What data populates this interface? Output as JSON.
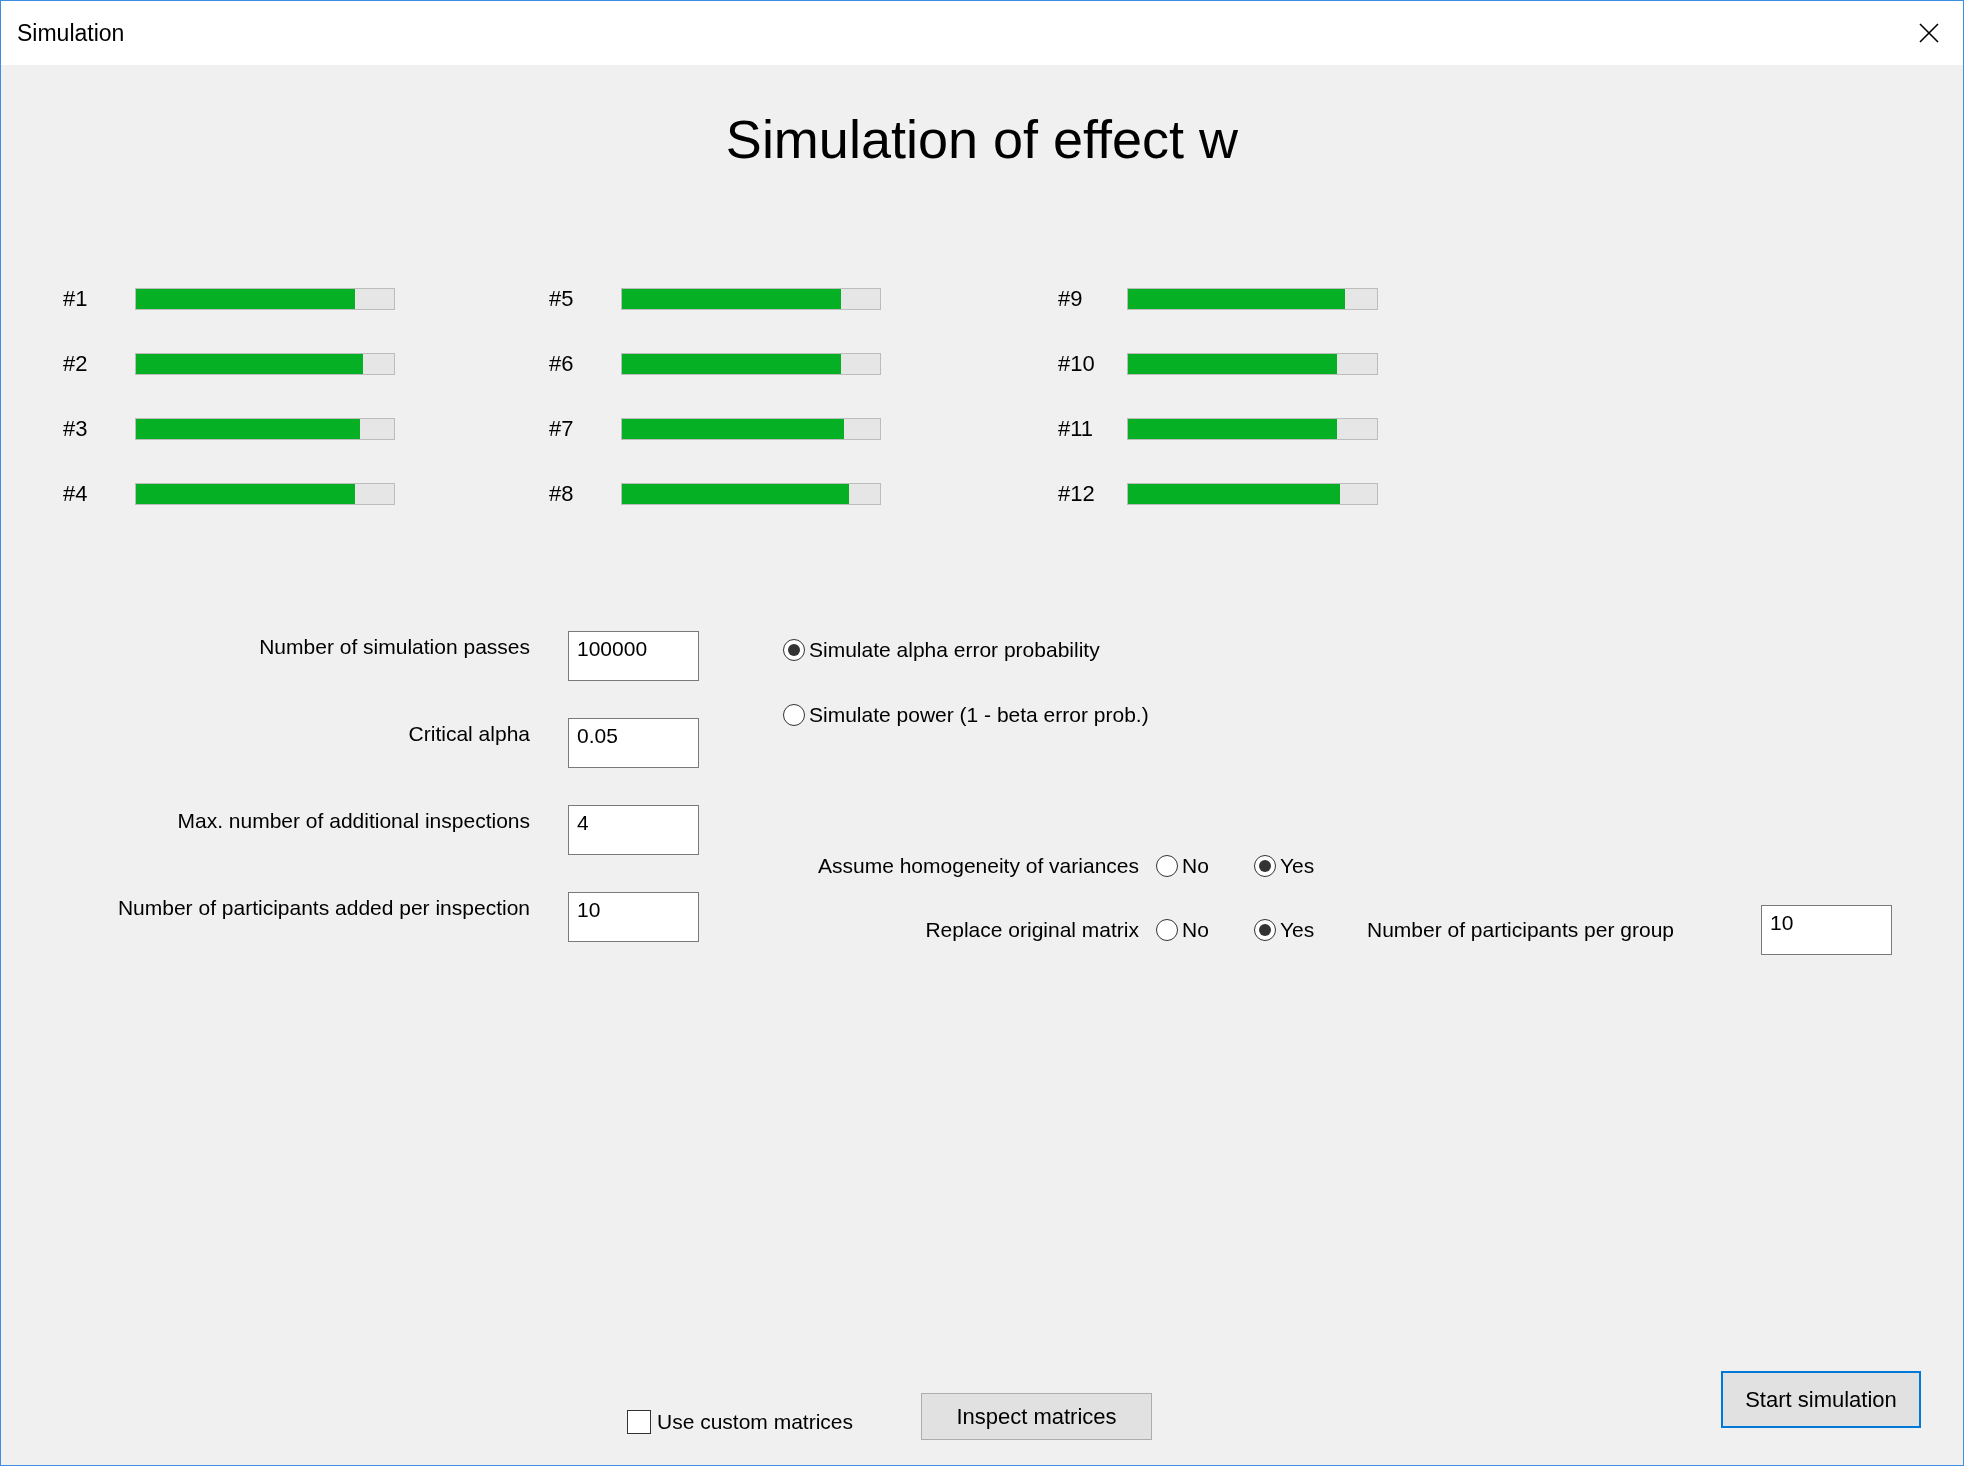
{
  "window": {
    "title": "Simulation"
  },
  "heading": "Simulation of effect w",
  "progress": [
    {
      "label": "#1",
      "level": 0.85
    },
    {
      "label": "#2",
      "level": 0.88
    },
    {
      "label": "#3",
      "level": 0.87
    },
    {
      "label": "#4",
      "level": 0.85
    },
    {
      "label": "#5",
      "level": 0.85
    },
    {
      "label": "#6",
      "level": 0.85
    },
    {
      "label": "#7",
      "level": 0.86
    },
    {
      "label": "#8",
      "level": 0.88
    },
    {
      "label": "#9",
      "level": 0.87
    },
    {
      "label": "#10",
      "level": 0.84
    },
    {
      "label": "#11",
      "level": 0.84
    },
    {
      "label": "#12",
      "level": 0.85
    }
  ],
  "fields": [
    {
      "label": "Number of simulation passes",
      "value": "100000"
    },
    {
      "label": "Critical alpha",
      "value": "0.05"
    },
    {
      "label": "Max. number of additional inspections",
      "value": "4"
    },
    {
      "label": "Number of participants added per inspection",
      "value": "10"
    }
  ],
  "mode_options": [
    {
      "label": "Simulate alpha error probability",
      "selected": true
    },
    {
      "label": "Simulate power (1 - beta error prob.)",
      "selected": false
    }
  ],
  "homogeneity": {
    "label": "Assume homogeneity of variances",
    "options": [
      {
        "label": "No",
        "selected": false
      },
      {
        "label": "Yes",
        "selected": true
      }
    ]
  },
  "replace_matrix": {
    "label": "Replace original matrix",
    "options": [
      {
        "label": "No",
        "selected": false
      },
      {
        "label": "Yes",
        "selected": true
      }
    ]
  },
  "participants_per_group": {
    "label": "Number of participants per group",
    "value": "10"
  },
  "custom_matrices": {
    "label": "Use custom matrices",
    "checked": false
  },
  "buttons": [
    {
      "label": "Inspect matrices",
      "kind": "normal"
    },
    {
      "label": "Start simulation",
      "kind": "default"
    }
  ]
}
